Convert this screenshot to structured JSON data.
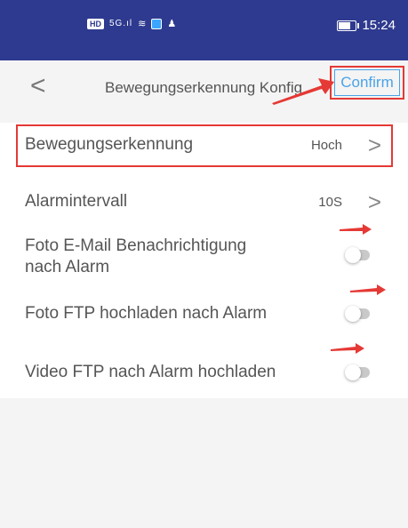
{
  "status_bar": {
    "hd": "HD",
    "network": "5G",
    "time": "15:24"
  },
  "nav": {
    "title": "Bewegungserkennung Konfig",
    "confirm_label": "Confirm"
  },
  "settings": [
    {
      "label": "Bewegungserkennung",
      "value": "Hoch"
    },
    {
      "label": "Alarmintervall",
      "value": "10S"
    },
    {
      "label_line1": "Foto E-Mail Benachrichtigung",
      "label_line2": "nach Alarm",
      "enabled": false
    },
    {
      "label": "Foto FTP hochladen nach Alarm",
      "enabled": false
    },
    {
      "label": "Video FTP nach Alarm hochladen",
      "enabled": false
    }
  ],
  "colors": {
    "status_bar": "#2e3a8f",
    "accent": "#4aa3e8",
    "annotation": "#e53935"
  }
}
